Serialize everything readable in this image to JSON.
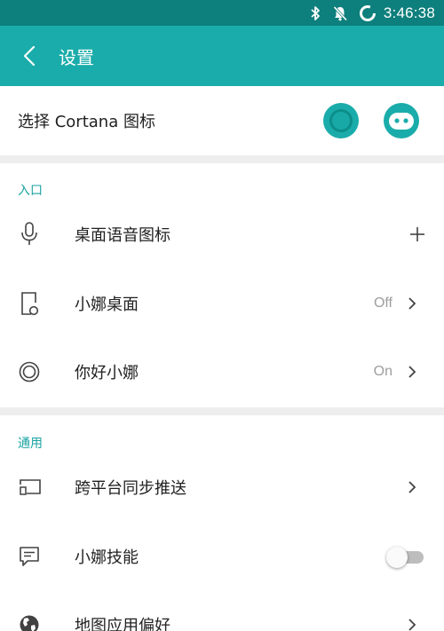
{
  "status_bar": {
    "time": "3:46:38"
  },
  "app_bar": {
    "title": "设置"
  },
  "cortana_icon": {
    "label": "选择 Cortana 图标"
  },
  "sections": {
    "entry": {
      "header": "入口",
      "items": [
        {
          "label": "桌面语音图标",
          "icon": "microphone-icon",
          "trailing": "plus-icon"
        },
        {
          "label": "小娜桌面",
          "icon": "phone-cortana-icon",
          "value": "Off",
          "trailing": "chevron-right-icon"
        },
        {
          "label": "你好小娜",
          "icon": "cortana-circle-icon",
          "value": "On",
          "trailing": "chevron-right-icon"
        }
      ]
    },
    "general": {
      "header": "通用",
      "items": [
        {
          "label": "跨平台同步推送",
          "icon": "cast-screen-icon",
          "trailing": "chevron-right-icon"
        },
        {
          "label": "小娜技能",
          "icon": "message-icon",
          "trailing": "toggle",
          "toggle_on": false
        },
        {
          "label": "地图应用偏好",
          "icon": "globe-icon",
          "trailing": "chevron-right-icon"
        }
      ]
    }
  },
  "colors": {
    "status_bar": "#0d7f7c",
    "app_bar": "#1aacaa",
    "accent": "#1aa3a1"
  }
}
